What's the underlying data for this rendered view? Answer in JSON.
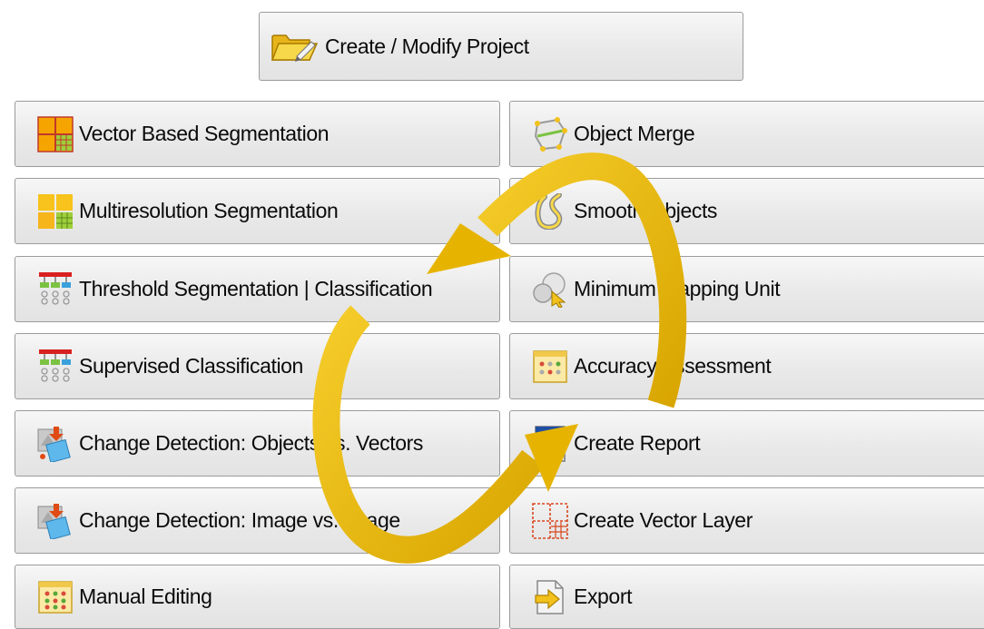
{
  "top_button": {
    "label": "Create / Modify Project",
    "icon": "folder-icon"
  },
  "left_column": [
    {
      "label": "Vector Based Segmentation",
      "icon": "vector-segmentation-icon"
    },
    {
      "label": "Multiresolution Segmentation",
      "icon": "multiresolution-segmentation-icon"
    },
    {
      "label": "Threshold Segmentation | Classification",
      "icon": "hierarchy-icon"
    },
    {
      "label": "Supervised Classification",
      "icon": "hierarchy-icon"
    },
    {
      "label": "Change Detection: Objects vs. Vectors",
      "icon": "change-detection-icon"
    },
    {
      "label": "Change Detection: Image vs. Image",
      "icon": "change-detection-icon"
    },
    {
      "label": "Manual Editing",
      "icon": "manual-editing-icon"
    }
  ],
  "right_column": [
    {
      "label": "Object Merge",
      "icon": "object-merge-icon"
    },
    {
      "label": "Smooth Objects",
      "icon": "smooth-objects-icon"
    },
    {
      "label": "Minimum Mapping Unit",
      "icon": "minimum-mapping-unit-icon"
    },
    {
      "label": "Accuracy Assessment",
      "icon": "accuracy-assessment-icon"
    },
    {
      "label": "Create Report",
      "icon": "report-icon"
    },
    {
      "label": "Create Vector Layer",
      "icon": "vector-layer-icon"
    },
    {
      "label": "Export",
      "icon": "export-icon"
    }
  ],
  "colors": {
    "arrow": "#e6b800",
    "button_border": "#9b9b9b",
    "button_face": "#e9e9e9"
  }
}
